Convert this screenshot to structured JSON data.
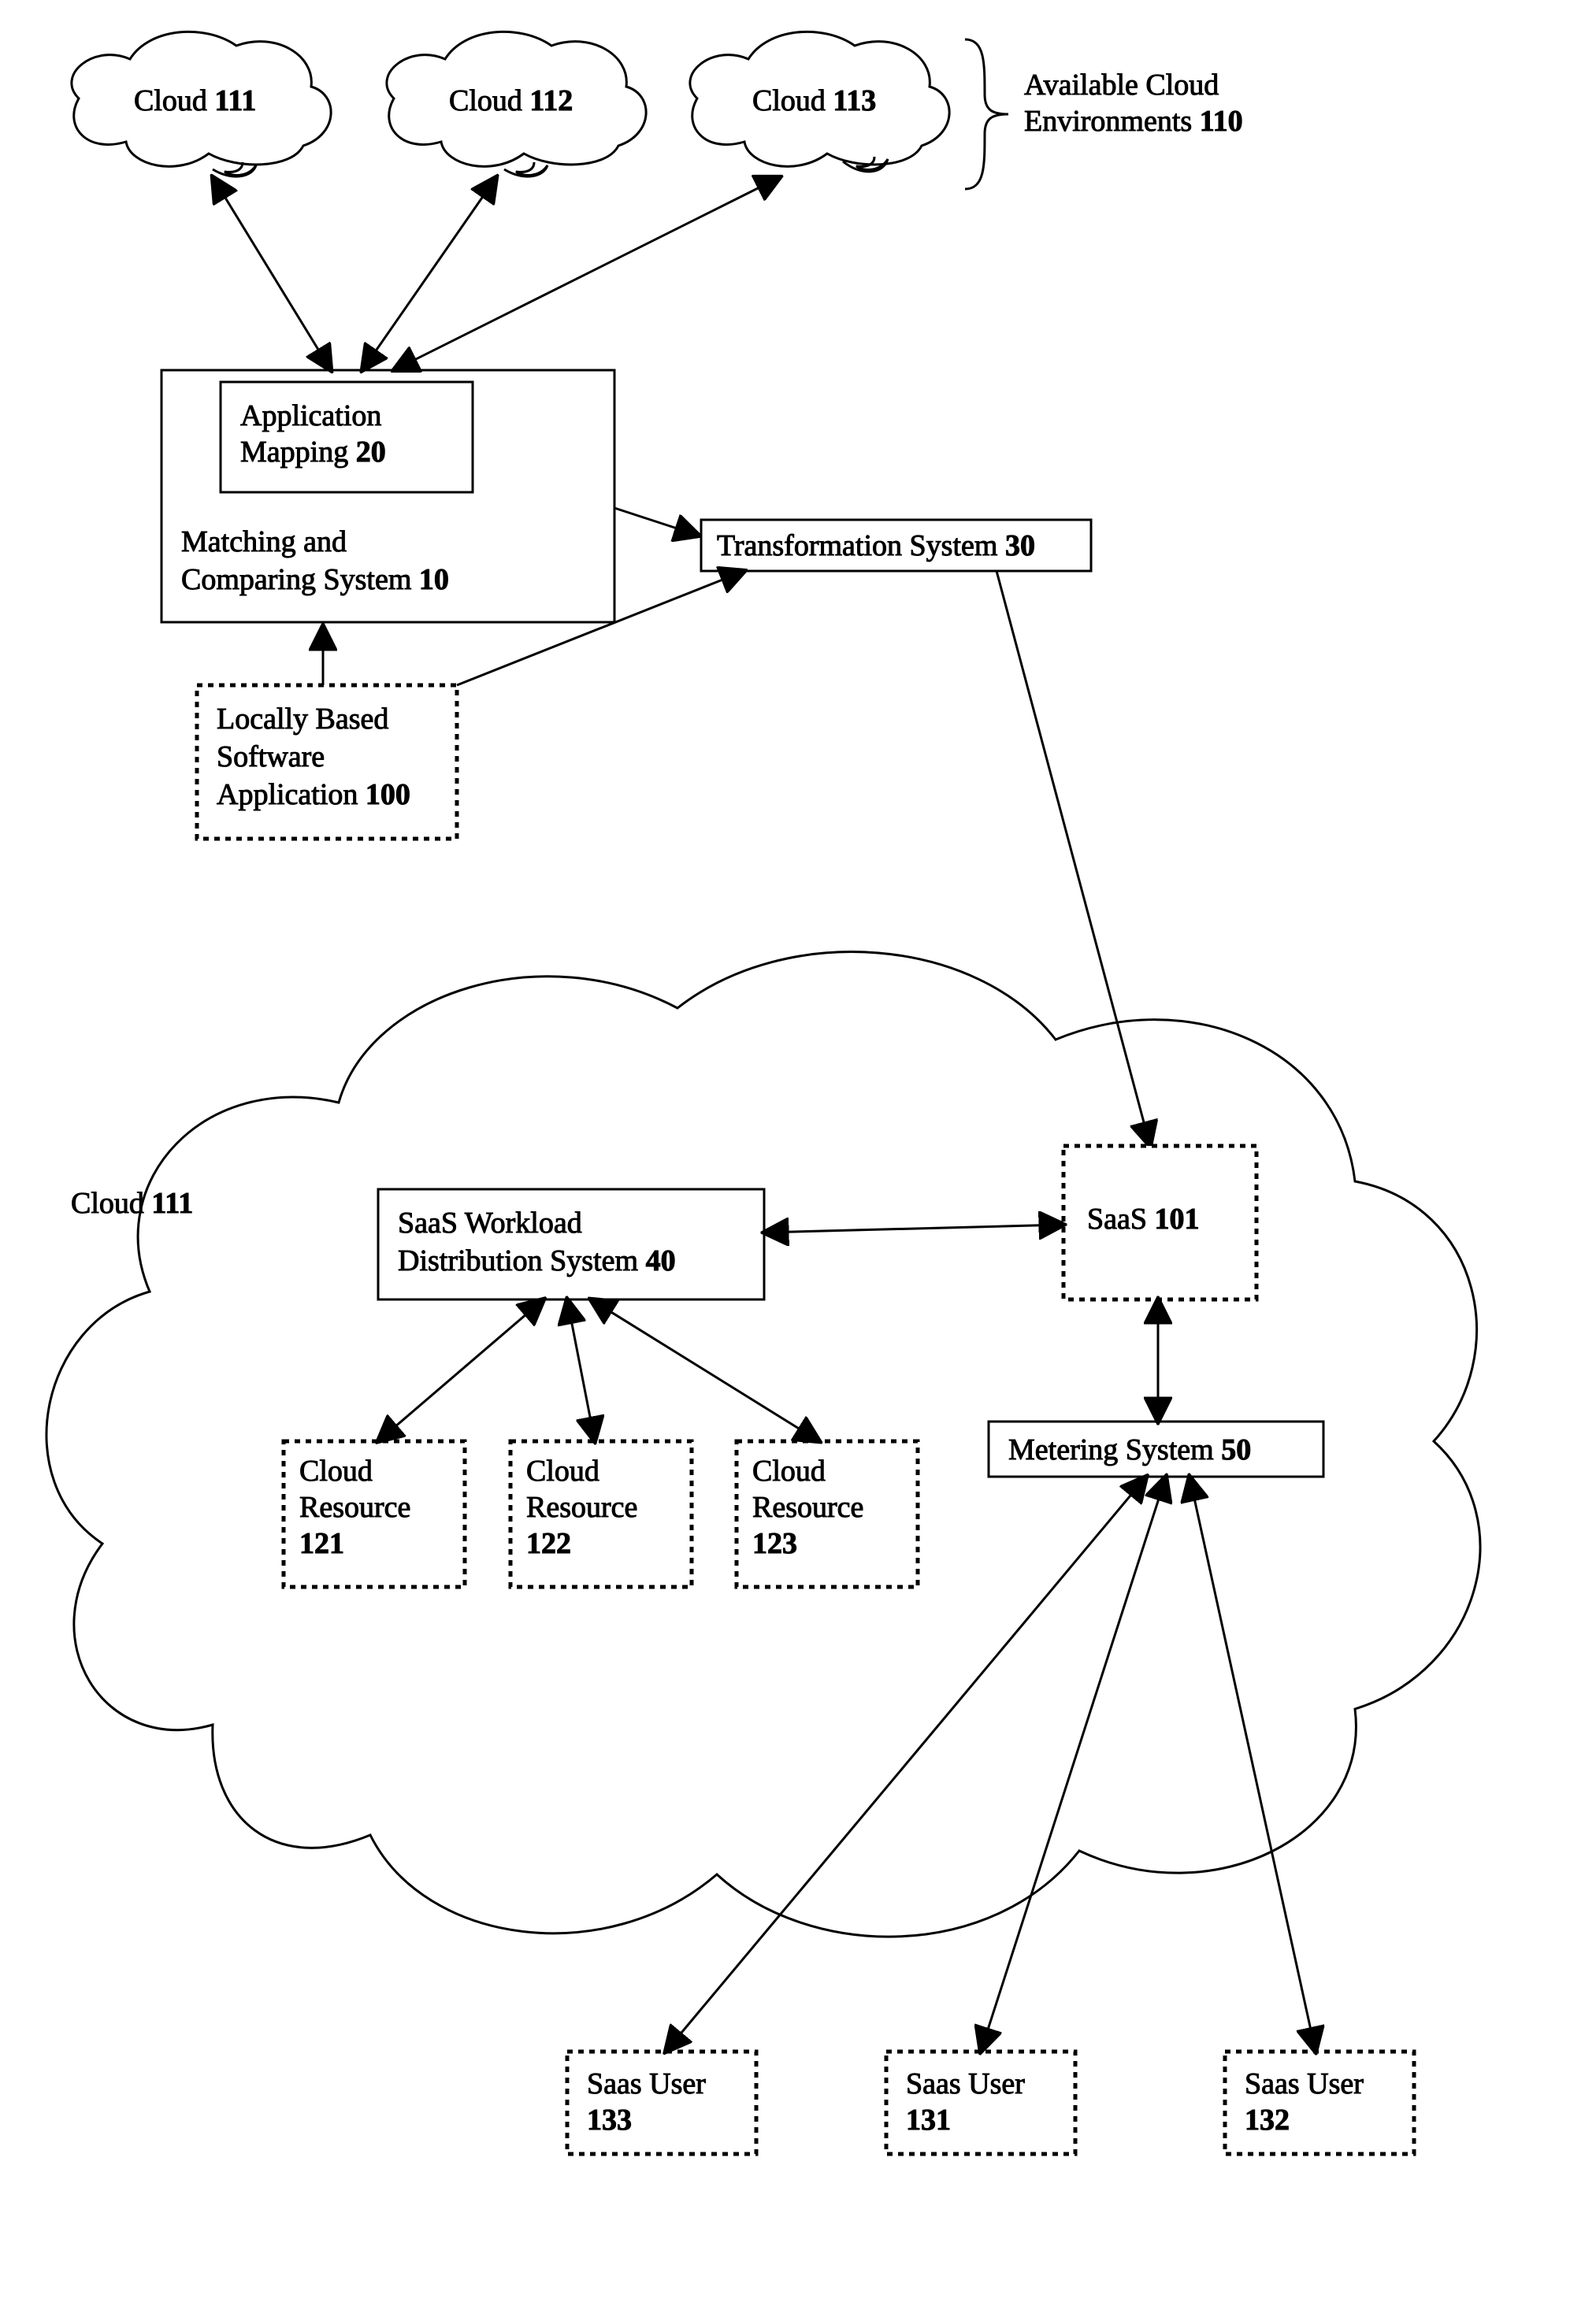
{
  "clouds": {
    "c111": {
      "name": "Cloud",
      "num": "111"
    },
    "c112": {
      "name": "Cloud",
      "num": "112"
    },
    "c113": {
      "name": "Cloud",
      "num": "113"
    }
  },
  "available_envs": {
    "line1": "Available Cloud",
    "line2": "Environments",
    "num": "110"
  },
  "appmapping": {
    "line1": "Application",
    "line2": "Mapping",
    "num": "20"
  },
  "matching": {
    "line1": "Matching and",
    "line2": "Comparing System",
    "num": "10"
  },
  "transformation": {
    "label": "Transformation System",
    "num": "30"
  },
  "locally": {
    "line1": "Locally Based",
    "line2": "Software",
    "line3": "Application",
    "num": "100"
  },
  "bigcloudlabel": {
    "name": "Cloud",
    "num": "111"
  },
  "workload": {
    "line1": "SaaS Workload",
    "line2": "Distribution System",
    "num": "40"
  },
  "saas101": {
    "name": "SaaS",
    "num": "101"
  },
  "metering": {
    "label": "Metering System",
    "num": "50"
  },
  "resources": {
    "r121": {
      "line1": "Cloud",
      "line2": "Resource",
      "num": "121"
    },
    "r122": {
      "line1": "Cloud",
      "line2": "Resource",
      "num": "122"
    },
    "r123": {
      "line1": "Cloud",
      "line2": "Resource",
      "num": "123"
    }
  },
  "users": {
    "u133": {
      "line1": "Saas User",
      "num": "133"
    },
    "u131": {
      "line1": "Saas User",
      "num": "131"
    },
    "u132": {
      "line1": "Saas User",
      "num": "132"
    }
  }
}
